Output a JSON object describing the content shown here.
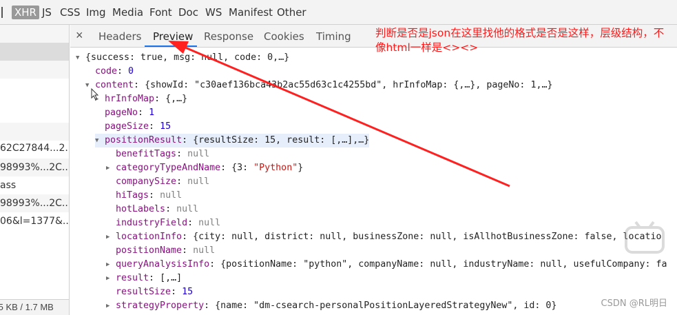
{
  "filters": {
    "items": [
      "XHR",
      "JS",
      "CSS",
      "Img",
      "Media",
      "Font",
      "Doc",
      "WS",
      "Manifest",
      "Other"
    ],
    "active": "XHR"
  },
  "left_rows": [
    "",
    "",
    "",
    "",
    "",
    "62C27844...2...",
    "98993%...2C...",
    "ass",
    "98993%...2C...",
    "06&l=1377&..."
  ],
  "left_footer": ".5 KB / 1.7 MB",
  "tabs": {
    "close_glyph": "×",
    "items": [
      "Headers",
      "Preview",
      "Response",
      "Cookies",
      "Timing"
    ],
    "active": "Preview"
  },
  "annotation": "判断是否是json在这里找他的格式是否是这样，层级结构，不像html一样是<><>",
  "tree": [
    {
      "text": "{success: true, msg: null, code: 0,…}"
    },
    {
      "key": "code",
      "value": "0"
    },
    {
      "key": "content",
      "value": "{showId: \"c30aef136bca43b2ac55d63c1c4255bd\", hrInfoMap: {,…}, pageNo: 1,…}"
    },
    {
      "key": "hrInfoMap",
      "value": "{,…}"
    },
    {
      "key": "pageNo",
      "value": "1"
    },
    {
      "key": "pageSize",
      "value": "15"
    },
    {
      "key": "positionResult",
      "value": "{resultSize: 15, result: [,…],…}"
    },
    {
      "key": "benefitTags",
      "value": "null"
    },
    {
      "key": "categoryTypeAndName",
      "value": "{3: \"Python\"}"
    },
    {
      "key": "companySize",
      "value": "null"
    },
    {
      "key": "hiTags",
      "value": "null"
    },
    {
      "key": "hotLabels",
      "value": "null"
    },
    {
      "key": "industryField",
      "value": "null"
    },
    {
      "key": "locationInfo",
      "value": "{city: null, district: null, businessZone: null, isAllhotBusinessZone: false, locatio"
    },
    {
      "key": "positionName",
      "value": "null"
    },
    {
      "key": "queryAnalysisInfo",
      "value": "{positionName: \"python\", companyName: null, industryName: null, usefulCompany: fa"
    },
    {
      "key": "result",
      "value": "[,…]"
    },
    {
      "key": "resultSize",
      "value": "15"
    },
    {
      "key": "strategyProperty",
      "value": "{name: \"dm-csearch-personalPositionLayeredStrategyNew\", id: 0}"
    }
  ],
  "watermark": "CSDN @RL明日",
  "colors": {
    "annotation": "#ff1a1a",
    "arrow": "#ff2020",
    "active_tab_underline": "#1a73e8"
  }
}
